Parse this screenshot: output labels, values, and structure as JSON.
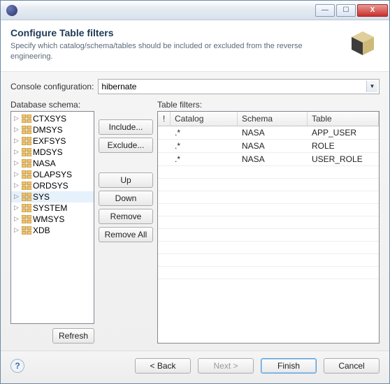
{
  "header": {
    "title": "Configure Table filters",
    "subtitle": "Specify which catalog/schema/tables should be included or excluded from the reverse engineering."
  },
  "console": {
    "label": "Console configuration:",
    "value": "hibernate"
  },
  "schema": {
    "label": "Database schema:",
    "items": [
      {
        "label": "CTXSYS",
        "selected": false
      },
      {
        "label": "DMSYS",
        "selected": false
      },
      {
        "label": "EXFSYS",
        "selected": false
      },
      {
        "label": "MDSYS",
        "selected": false
      },
      {
        "label": "NASA",
        "selected": false
      },
      {
        "label": "OLAPSYS",
        "selected": false
      },
      {
        "label": "ORDSYS",
        "selected": false
      },
      {
        "label": "SYS",
        "selected": true
      },
      {
        "label": "SYSTEM",
        "selected": false
      },
      {
        "label": "WMSYS",
        "selected": false
      },
      {
        "label": "XDB",
        "selected": false
      }
    ],
    "refresh_label": "Refresh"
  },
  "buttons": {
    "include": "Include...",
    "exclude": "Exclude...",
    "up": "Up",
    "down": "Down",
    "remove": "Remove",
    "remove_all": "Remove All"
  },
  "filters": {
    "label": "Table filters:",
    "columns": {
      "bang": "!",
      "catalog": "Catalog",
      "schema": "Schema",
      "table": "Table"
    },
    "rows": [
      {
        "bang": "",
        "catalog": ".*",
        "schema": "NASA",
        "table": "APP_USER"
      },
      {
        "bang": "",
        "catalog": ".*",
        "schema": "NASA",
        "table": "ROLE"
      },
      {
        "bang": "",
        "catalog": ".*",
        "schema": "NASA",
        "table": "USER_ROLE"
      }
    ]
  },
  "footer": {
    "back": "< Back",
    "next": "Next >",
    "finish": "Finish",
    "cancel": "Cancel"
  }
}
